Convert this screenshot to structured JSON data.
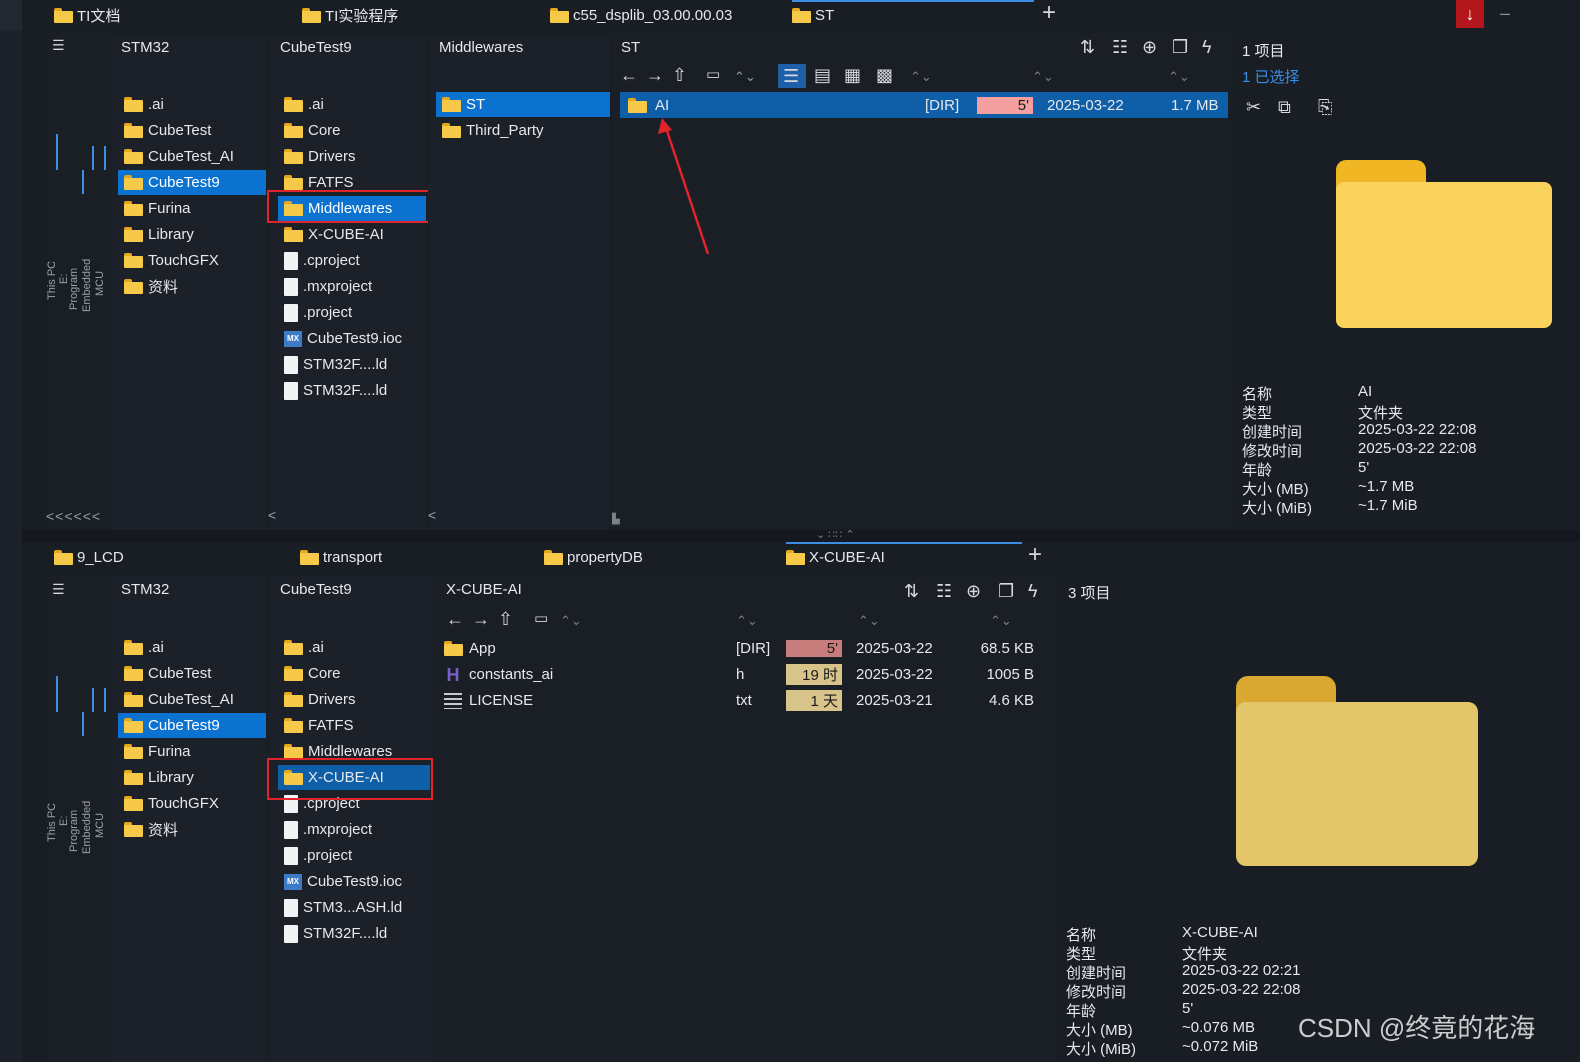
{
  "top": {
    "tabs": [
      {
        "label": "TI文档"
      },
      {
        "label": "TI实验程序"
      },
      {
        "label": "c55_dsplib_03.00.00.03"
      },
      {
        "label": "ST"
      }
    ],
    "col1": {
      "title": "STM32",
      "items": [
        ".ai",
        "CubeTest",
        "CubeTest_AI",
        "CubeTest9",
        "Furina",
        "Library",
        "TouchGFX",
        "资料"
      ],
      "selected": 3
    },
    "col2": {
      "title": "CubeTest9",
      "items": [
        ".ai",
        "Core",
        "Drivers",
        "FATFS",
        "Middlewares",
        "X-CUBE-AI",
        ".cproject",
        ".mxproject",
        ".project",
        "CubeTest9.ioc",
        "STM32F....ld",
        "STM32F....ld"
      ],
      "selected": 4
    },
    "col3": {
      "title": "Middlewares",
      "items": [
        "ST",
        "Third_Party"
      ],
      "selected": 0
    },
    "main": {
      "title": "ST",
      "rows": [
        {
          "name": "AI",
          "type": "[DIR]",
          "age": "5'",
          "date": "2025-03-22",
          "size": "1.7 MB"
        }
      ]
    },
    "tree_labels": [
      "This PC",
      "E:",
      "Program",
      "Embedded",
      "MCU"
    ],
    "info": {
      "count": "1 项目",
      "selected": "1 已选择",
      "props": [
        {
          "k": "名称",
          "v": "AI"
        },
        {
          "k": "类型",
          "v": "文件夹"
        },
        {
          "k": "创建时间",
          "v": "2025-03-22  22:08"
        },
        {
          "k": "修改时间",
          "v": "2025-03-22  22:08"
        },
        {
          "k": "年龄",
          "v": "5'"
        },
        {
          "k": "大小 (MB)",
          "v": "~1.7 MB"
        },
        {
          "k": "大小 (MiB)",
          "v": "~1.7 MiB"
        }
      ]
    }
  },
  "bottom": {
    "tabs": [
      {
        "label": "9_LCD"
      },
      {
        "label": "transport"
      },
      {
        "label": "propertyDB"
      },
      {
        "label": "X-CUBE-AI"
      }
    ],
    "col1": {
      "title": "STM32",
      "items": [
        ".ai",
        "CubeTest",
        "CubeTest_AI",
        "CubeTest9",
        "Furina",
        "Library",
        "TouchGFX",
        "资料"
      ],
      "selected": 3
    },
    "col2": {
      "title": "CubeTest9",
      "items": [
        ".ai",
        "Core",
        "Drivers",
        "FATFS",
        "Middlewares",
        "X-CUBE-AI",
        ".cproject",
        ".mxproject",
        ".project",
        "CubeTest9.ioc",
        "STM3...ASH.ld",
        "STM32F....ld"
      ],
      "selected": 5
    },
    "main": {
      "title": "X-CUBE-AI",
      "rows": [
        {
          "name": "App",
          "type": "[DIR]",
          "age": "5'",
          "date": "2025-03-22",
          "size": "68.5 KB"
        },
        {
          "name": "constants_ai",
          "type": "h",
          "age": "19 时",
          "date": "2025-03-22",
          "size": "1005 B"
        },
        {
          "name": "LICENSE",
          "type": "txt",
          "age": "1 天",
          "date": "2025-03-21",
          "size": "4.6 KB"
        }
      ]
    },
    "tree_labels": [
      "This PC",
      "E:",
      "Program",
      "Embedded",
      "MCU"
    ],
    "info": {
      "count": "3 项目",
      "props": [
        {
          "k": "名称",
          "v": "X-CUBE-AI"
        },
        {
          "k": "类型",
          "v": "文件夹"
        },
        {
          "k": "创建时间",
          "v": "2025-03-22  02:21"
        },
        {
          "k": "修改时间",
          "v": "2025-03-22  22:08"
        },
        {
          "k": "年龄",
          "v": "5'"
        },
        {
          "k": "大小 (MB)",
          "v": "~0.076 MB"
        },
        {
          "k": "大小 (MiB)",
          "v": "~0.072 MiB"
        }
      ]
    }
  },
  "watermark": "CSDN @终竟的花海",
  "colors": {
    "selection": "#0c72d0",
    "age_red": "#f4a0a0",
    "age_darkred": "#c97c7c",
    "age_tan": "#d8c38a",
    "annotation": "#e0242b"
  }
}
